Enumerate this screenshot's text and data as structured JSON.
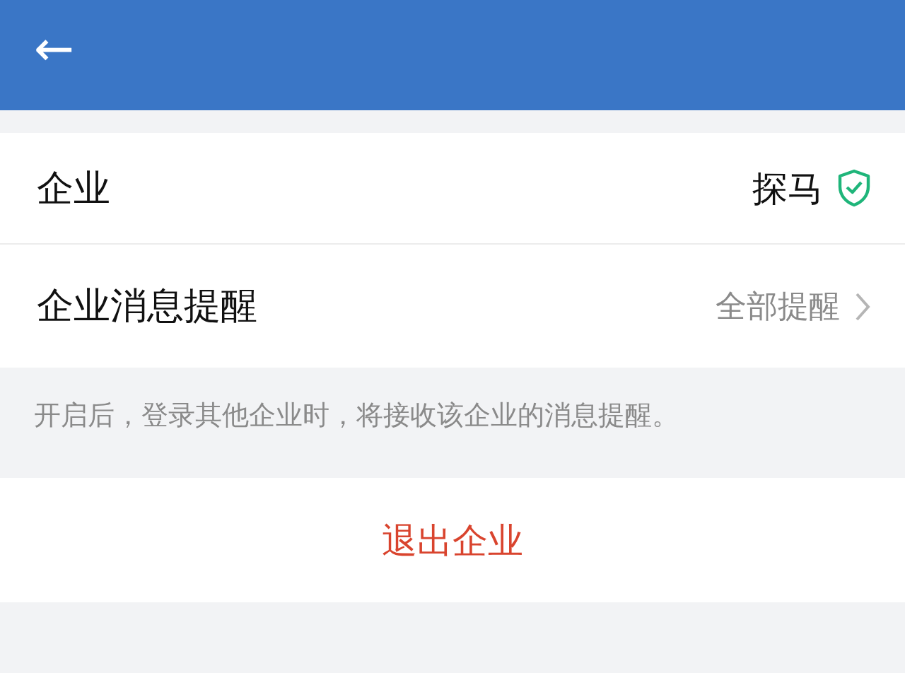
{
  "header": {
    "back": "←"
  },
  "rows": [
    {
      "kind": "verified",
      "label": "企业",
      "value": "探马"
    },
    {
      "kind": "link",
      "label": "企业消息提醒",
      "value": "全部提醒"
    }
  ],
  "hint": "开启后，登录其他企业时，将接收该企业的消息提醒。",
  "exit_button": "退出企业"
}
